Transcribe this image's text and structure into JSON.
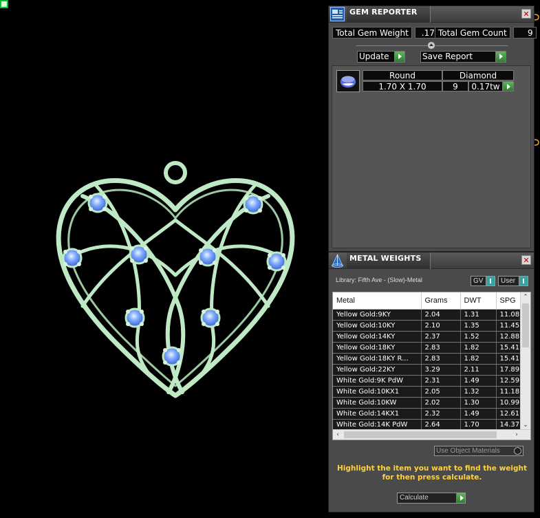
{
  "gem_reporter": {
    "title": "GEM REPORTER",
    "close_label": "✕",
    "total_weight_label": "Total Gem Weight",
    "total_weight_value": ".17",
    "total_count_label": "Total Gem Count",
    "total_count_value": "9",
    "update_label": "Update",
    "save_report_label": "Save Report",
    "gem": {
      "shape": "Round",
      "material": "Diamond",
      "size": "1.70 X 1.70",
      "count": "9",
      "weight": "0.17tw"
    }
  },
  "metal_weights": {
    "title": "METAL WEIGHTS",
    "close_label": "✕",
    "library_label": "Library: Fifth Ave - (Slow)-Metal",
    "gv_label": "GV",
    "user_label": "User",
    "columns": [
      "Metal",
      "Grams",
      "DWT",
      "SPG"
    ],
    "rows": [
      [
        "Yellow Gold:9KY",
        "2.04",
        "1.31",
        "11.08"
      ],
      [
        "Yellow Gold:10KY",
        "2.10",
        "1.35",
        "11.45"
      ],
      [
        "Yellow Gold:14KY",
        "2.37",
        "1.52",
        "12.88"
      ],
      [
        "Yellow Gold:18KY",
        "2.83",
        "1.82",
        "15.41"
      ],
      [
        "Yellow Gold:18KY R...",
        "2.83",
        "1.82",
        "15.41"
      ],
      [
        "Yellow Gold:22KY",
        "3.29",
        "2.11",
        "17.89"
      ],
      [
        "White Gold:9K PdW",
        "2.31",
        "1.49",
        "12.59"
      ],
      [
        "White Gold:10KX1",
        "2.05",
        "1.32",
        "11.18"
      ],
      [
        "White Gold:10KW",
        "2.02",
        "1.30",
        "10.99"
      ],
      [
        "White Gold:14KX1",
        "2.32",
        "1.49",
        "12.61"
      ],
      [
        "White Gold:14K PdW",
        "2.64",
        "1.70",
        "14.37"
      ]
    ],
    "use_object_materials_label": "Use Object Materials",
    "hint": "Highlight the item you want to find the weight for then press calculate.",
    "calculate_label": "Calculate"
  },
  "colors": {
    "panel_bg": "#4a4a4a",
    "metal_green": "#bfe8c4",
    "gem_blue": "#5b8ef0",
    "hint_yellow": "#ffd23c",
    "go_green": "#3e9b3e"
  }
}
